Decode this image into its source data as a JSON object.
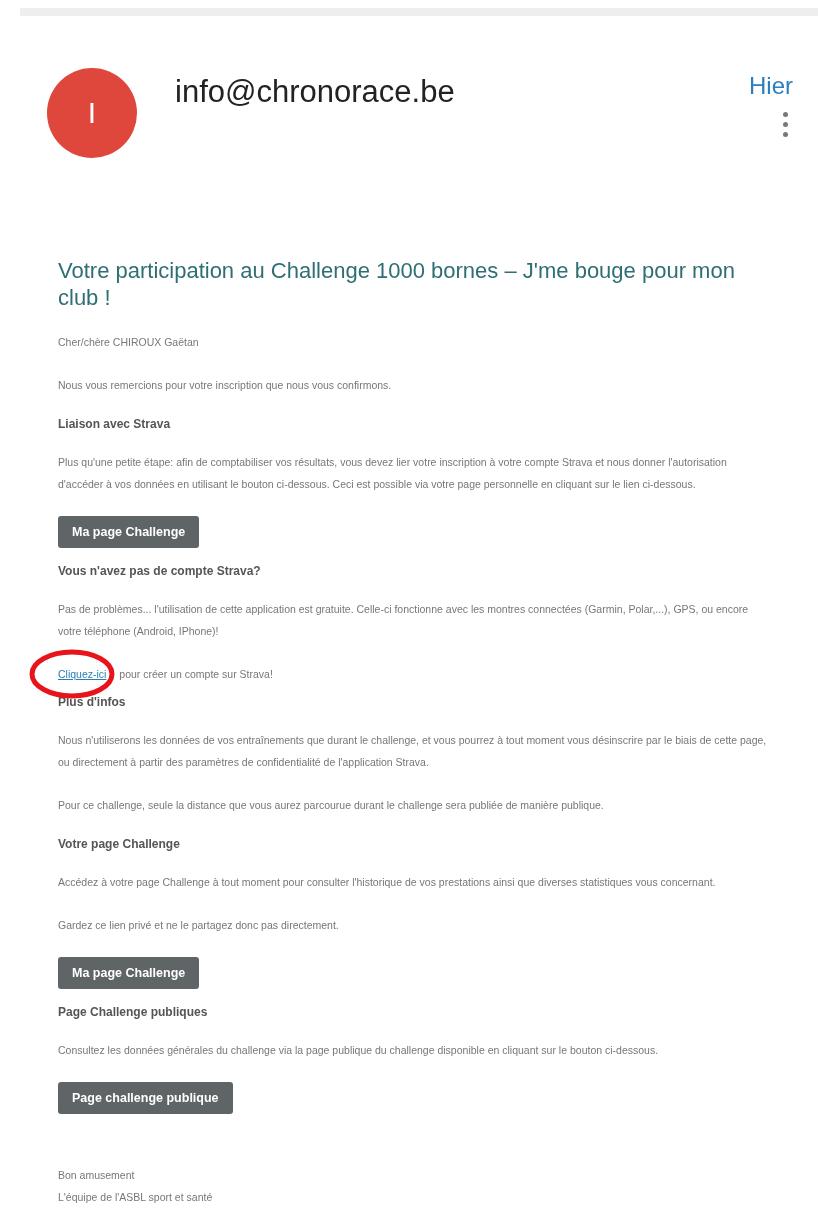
{
  "header": {
    "avatar_letter": "I",
    "sender": "info@chronorace.be",
    "date": "Hier"
  },
  "message": {
    "title": "Votre participation au Challenge 1000 bornes – J'me bouge pour mon club !",
    "blocks": [
      {
        "kind": "paragraph",
        "text": "Cher/chère CHIROUX Gaëtan"
      },
      {
        "kind": "paragraph",
        "text": "Nous vous remercions pour votre inscription que nous vous confirmons."
      },
      {
        "kind": "heading",
        "text": "Liaison avec Strava"
      },
      {
        "kind": "paragraph",
        "text": "Plus qu'une petite étape: afin de comptabiliser vos résultats, vous devez lier votre inscription à votre compte Strava et nous donner l'autorisation d'accéder à vos données en utilisant le bouton ci-dessous. Ceci est possible via votre page personnelle en cliquant sur le lien ci-dessous."
      },
      {
        "kind": "button",
        "text": "Ma page Challenge"
      },
      {
        "kind": "heading",
        "text": "Vous n'avez pas de compte Strava?"
      },
      {
        "kind": "paragraph",
        "text": "Pas de problèmes... l'utilisation de cette application est gratuite. Celle-ci fonctionne avec les montres connectées (Garmin, Polar,...), GPS, ou encore votre téléphone (Android, IPhone)!"
      },
      {
        "kind": "link_paragraph",
        "link": "Cliquez-ici",
        "text": " pour créer un compte sur Strava!",
        "circled": true
      },
      {
        "kind": "heading",
        "text": "Plus d'infos"
      },
      {
        "kind": "paragraph",
        "text": "Nous n'utiliserons les données de vos entraînements que durant le challenge, et vous pourrez à tout moment vous désinscrire par le biais de cette page, ou directement à partir des paramètres de confidentialité de l'application Strava."
      },
      {
        "kind": "paragraph",
        "text": "Pour ce challenge, seule la distance que vous aurez parcourue durant le challenge sera publiée de manière publique."
      },
      {
        "kind": "heading",
        "text": "Votre page Challenge"
      },
      {
        "kind": "paragraph",
        "text": "Accédez à votre page Challenge à tout moment pour consulter l'historique de vos prestations ainsi que diverses statistiques vous concernant."
      },
      {
        "kind": "paragraph",
        "text": "Gardez ce lien privé et ne le partagez donc pas directement."
      },
      {
        "kind": "button",
        "text": "Ma page Challenge"
      },
      {
        "kind": "heading",
        "text": "Page Challenge publiques"
      },
      {
        "kind": "paragraph",
        "text": "Consultez les données générales du challenge via la page publique du challenge disponible en cliquant sur le bouton ci-dessous."
      },
      {
        "kind": "button",
        "text": "Page challenge publique"
      },
      {
        "kind": "signature",
        "lines": [
          "Bon amusement",
          "L'équipe de l'ASBL sport et santé"
        ]
      }
    ]
  }
}
